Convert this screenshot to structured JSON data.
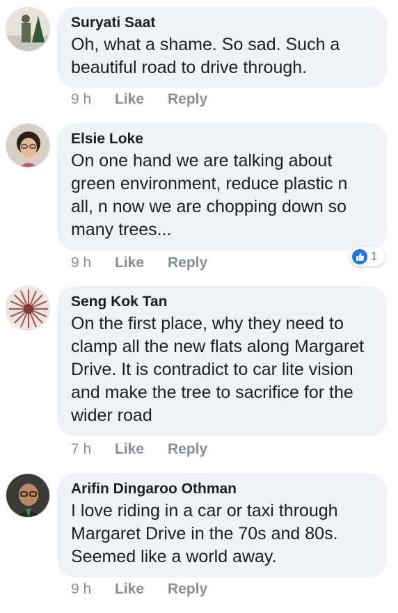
{
  "comments": [
    {
      "author": "Suryati Saat",
      "text": "Oh, what a shame. So sad. Such a beautiful road to drive through.",
      "time": "9 h",
      "like": "Like",
      "reply": "Reply",
      "avatar": "photo-person-outdoors"
    },
    {
      "author": "Elsie Loke",
      "text": "On one hand we are talking about green environment, reduce plastic n all, n now we are chopping down so many trees...",
      "time": "9 h",
      "like": "Like",
      "reply": "Reply",
      "avatar": "photo-woman-glasses",
      "reaction": {
        "icon": "thumbs-up-icon",
        "count": "1",
        "color": "#1877f2"
      }
    },
    {
      "author": "Seng Kok Tan",
      "text": "On the first place, why they need to clamp all the  new flats along Margaret Drive. It is contradict to car lite vision and make the tree to sacrifice for the wider road",
      "time": "7 h",
      "like": "Like",
      "reply": "Reply",
      "avatar": "radial-pattern"
    },
    {
      "author": "Arifin Dingaroo Othman",
      "text": "I love riding in a car or taxi through Margaret Drive in the 70s and 80s. Seemed like a world away.",
      "time": "9 h",
      "like": "Like",
      "reply": "Reply",
      "avatar": "photo-man-glasses"
    }
  ]
}
